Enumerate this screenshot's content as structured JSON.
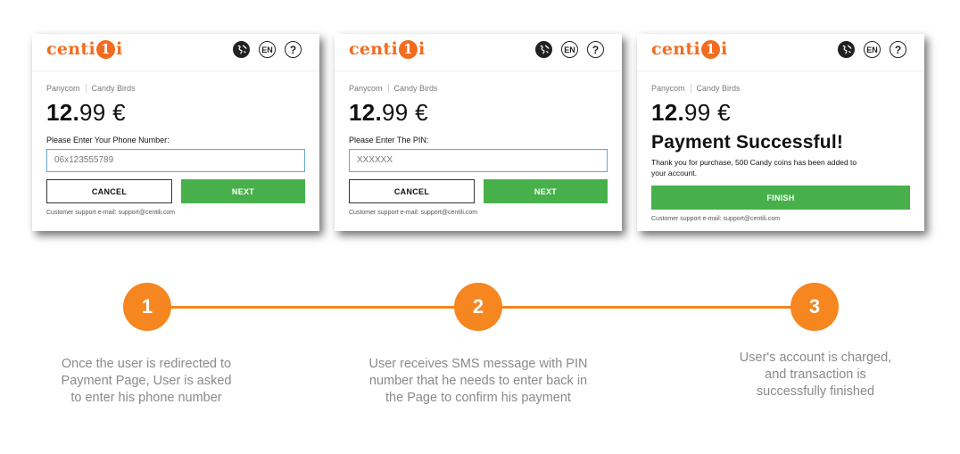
{
  "colors": {
    "accent": "#f26c1f",
    "timeline": "#f6861f",
    "primary_button": "#47b04b",
    "input_border": "#62a8d4"
  },
  "header": {
    "logo_prefix": "centi",
    "logo_circle": "1",
    "logo_suffix": "i",
    "icons": [
      "globe-icon",
      "language-icon",
      "help-icon"
    ],
    "language_label": "EN",
    "help_label": "?"
  },
  "cards": [
    {
      "merchant": "Panycom",
      "product": "Candy Birds",
      "price_int": "12.",
      "price_rest": "99 €",
      "input_label": "Please Enter Your Phone Number:",
      "input_value": "06x123555789",
      "cancel_label": "CANCEL",
      "next_label": "NEXT",
      "support": "Customer support e-mail: support@centili.com"
    },
    {
      "merchant": "Panycom",
      "product": "Candy Birds",
      "price_int": "12.",
      "price_rest": "99 €",
      "input_label": "Please Enter The PIN:",
      "input_value": "XXXXXX",
      "cancel_label": "CANCEL",
      "next_label": "NEXT",
      "support": "Customer support e-mail: support@centili.com"
    },
    {
      "merchant": "Panycom",
      "product": "Candy Birds",
      "price_int": "12.",
      "price_rest": "99 €",
      "success_title": "Payment Successful!",
      "success_message": "Thank you for purchase, 500 Candy coins has been added to your account.",
      "finish_label": "FINISH",
      "support": "Customer support e-mail: support@centili.com"
    }
  ],
  "steps": [
    {
      "number": "1",
      "text": "Once the user is redirected to Payment Page, User is asked to enter his phone number"
    },
    {
      "number": "2",
      "text": "User receives SMS message with PIN number that he needs to enter back in the Page to confirm his payment"
    },
    {
      "number": "3",
      "text": "User's account is charged, and transaction is successfully finished"
    }
  ]
}
